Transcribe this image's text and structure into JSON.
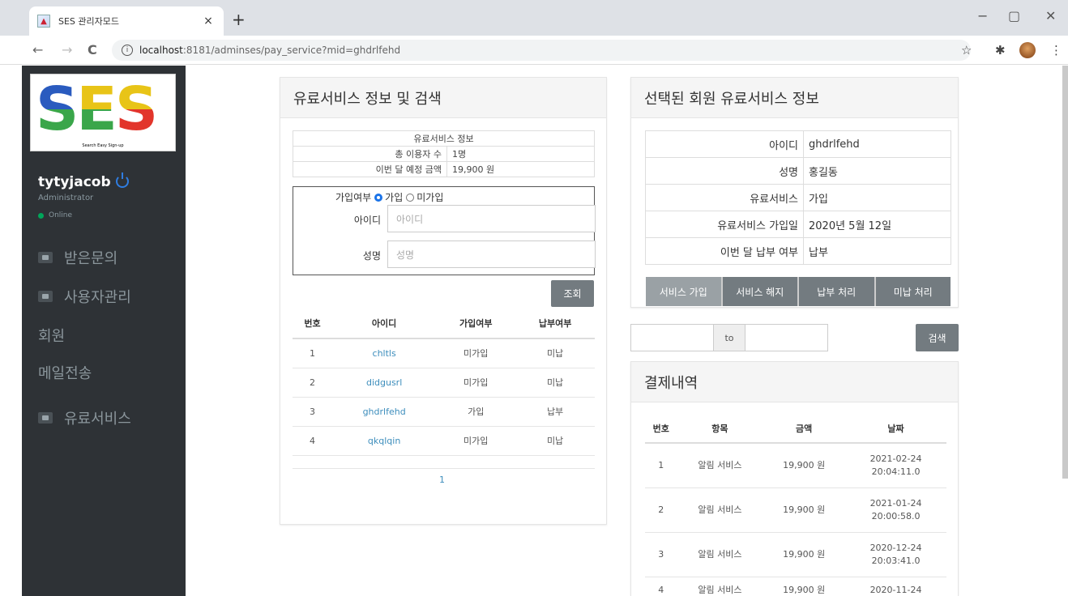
{
  "browser": {
    "tab_title": "SES 관리자모드",
    "tab_close": "×",
    "new_tab": "+",
    "url_host": "localhost",
    "url_rest": ":8181/adminses/pay_service?mid=ghdrlfehd",
    "win_min": "−",
    "win_max": "▢",
    "win_close": "✕",
    "back": "←",
    "forward": "→",
    "reload": "C",
    "star": "☆",
    "puzzle": "✱",
    "menu": "⋮"
  },
  "sidebar": {
    "logo_letters": [
      "S",
      "E",
      "S"
    ],
    "logo_colors": [
      "#2a5bbf",
      "#e8c417",
      "#3aa64a",
      "#e2352b"
    ],
    "logo_sub": "Search Easy Sign-up",
    "user_name": "tytyjacob",
    "user_role": "Administrator",
    "user_status": "Online",
    "items": [
      {
        "label": "받은문의",
        "icon": "chat-icon"
      },
      {
        "label": "사용자관리",
        "icon": "user-icon"
      },
      {
        "label": "회원"
      },
      {
        "label": "메일전송"
      },
      {
        "label": "유료서비스",
        "icon": "card-icon"
      }
    ]
  },
  "left_panel": {
    "title": "유료서비스 정보 및 검색",
    "info_caption": "유료서비스 정보",
    "info_rows": [
      {
        "key": "총 이용자 수",
        "value": "1명"
      },
      {
        "key": "이번 달 예정 금액",
        "value": "19,900 원"
      }
    ],
    "join_label": "가입여부",
    "radio_join": "가입",
    "radio_notjoin": "미가입",
    "id_label": "아이디",
    "id_placeholder": "아이디",
    "name_label": "성명",
    "name_placeholder": "성명",
    "search_button": "조회",
    "table_headers": [
      "번호",
      "아이디",
      "가입여부",
      "납부여부"
    ],
    "rows": [
      {
        "no": "1",
        "id": "chltls",
        "join": "미가입",
        "paid": "미납"
      },
      {
        "no": "2",
        "id": "didgusrl",
        "join": "미가입",
        "paid": "미납"
      },
      {
        "no": "3",
        "id": "ghdrlfehd",
        "join": "가입",
        "paid": "납부"
      },
      {
        "no": "4",
        "id": "qkqlqin",
        "join": "미가입",
        "paid": "미납"
      }
    ],
    "page": "1"
  },
  "right_panel": {
    "title": "선택된 회원 유료서비스 정보",
    "details": [
      {
        "key": "아이디",
        "value": "ghdrlfehd"
      },
      {
        "key": "성명",
        "value": "홍길동"
      },
      {
        "key": "유료서비스",
        "value": "가입"
      },
      {
        "key": "유료서비스 가입일",
        "value": "2020년 5월 12일"
      },
      {
        "key": "이번 달 납부 여부",
        "value": "납부"
      }
    ],
    "actions": [
      "서비스 가입",
      "서비스 해지",
      "납부 처리",
      "미납 처리"
    ]
  },
  "date_search": {
    "to_label": "to",
    "button": "검색"
  },
  "payments": {
    "title": "결제내역",
    "headers": [
      "번호",
      "항목",
      "금액",
      "날짜"
    ],
    "rows": [
      {
        "no": "1",
        "item": "알림 서비스",
        "amount": "19,900 원",
        "date": "2021-02-24",
        "time": "20:04:11.0"
      },
      {
        "no": "2",
        "item": "알림 서비스",
        "amount": "19,900 원",
        "date": "2021-01-24",
        "time": "20:00:58.0"
      },
      {
        "no": "3",
        "item": "알림 서비스",
        "amount": "19,900 원",
        "date": "2020-12-24",
        "time": "20:03:41.0"
      },
      {
        "no": "4",
        "item": "알림 서비스",
        "amount": "19,900 원",
        "date": "2020-11-24",
        "time": ""
      }
    ]
  }
}
